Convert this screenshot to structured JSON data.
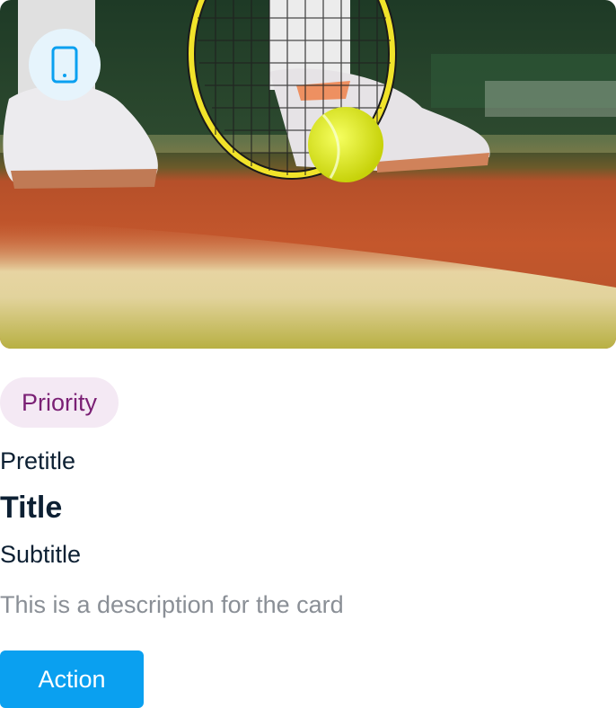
{
  "card": {
    "media": {
      "alt_subject": "",
      "badge_icon": "smartphone-icon",
      "accent": "#0aa0f0"
    },
    "chip": {
      "label": "Priority",
      "color": "#7a1f74",
      "background": "#f4e9f4"
    },
    "pretitle": "Pretitle",
    "title": "Title",
    "subtitle": "Subtitle",
    "description": "This is a description for the card",
    "action": {
      "label": "Action",
      "color": "#0aa0f0"
    }
  }
}
